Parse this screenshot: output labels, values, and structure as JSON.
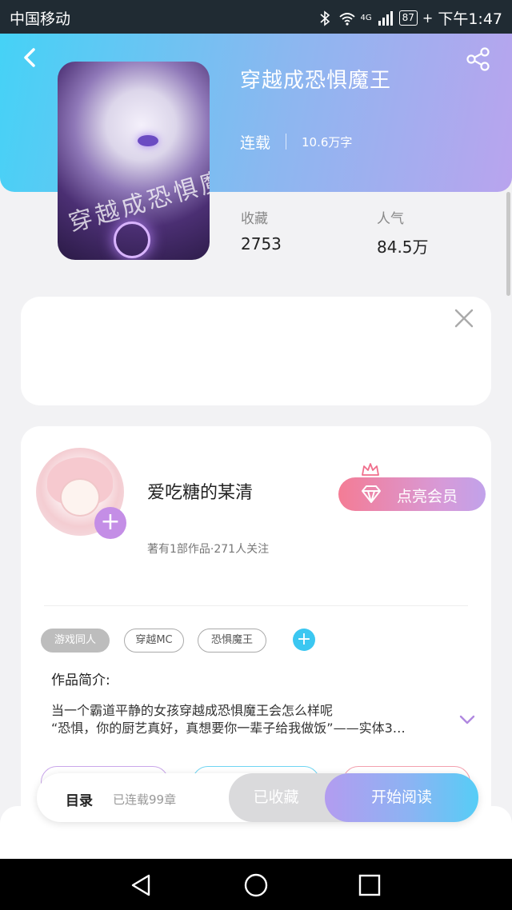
{
  "status_bar": {
    "carrier": "中国移动",
    "network": "4G",
    "battery": "87",
    "time": "下午1:47"
  },
  "book": {
    "title": "穿越成恐惧魔王",
    "status": "连载",
    "word_count": "10.6万字",
    "cover_watermark": "穿越成恐惧魔",
    "stats": [
      {
        "label": "收藏",
        "value": "2753"
      },
      {
        "label": "人气",
        "value": "84.5万"
      }
    ]
  },
  "author": {
    "name": "爱吃糖的某清",
    "meta": "著有1部作品·271人关注",
    "follow_plus": "+",
    "vip_label": "点亮会员"
  },
  "tags": [
    "游戏同人",
    "穿越MC",
    "恐惧魔王"
  ],
  "tag_add": "+",
  "intro": {
    "title": "作品简介:",
    "lines": [
      "当一个霸道平静的女孩穿越成恐惧魔王会怎么样呢",
      "“恐惧，你的厨艺真好，真想要你一辈子给我做饭”——实体3…"
    ]
  },
  "bottom_bar": {
    "toc_label": "目录",
    "toc_status": "已连载99章",
    "collected_label": "已收藏",
    "read_label": "开始阅读"
  },
  "icons": {
    "back": "chevron-left-icon",
    "share": "share-icon",
    "close": "close-icon",
    "crown": "crown-icon",
    "diamond": "diamond-icon",
    "expand": "chevron-down-icon"
  },
  "colors": {
    "header_gradient_start": "#45d2f6",
    "header_gradient_end": "#b9a4ee",
    "tag_add": "#3bc7f1",
    "vip_start": "#f47c95",
    "vip_end": "#c1a2ea",
    "accent_purple": "#c48ee6"
  }
}
